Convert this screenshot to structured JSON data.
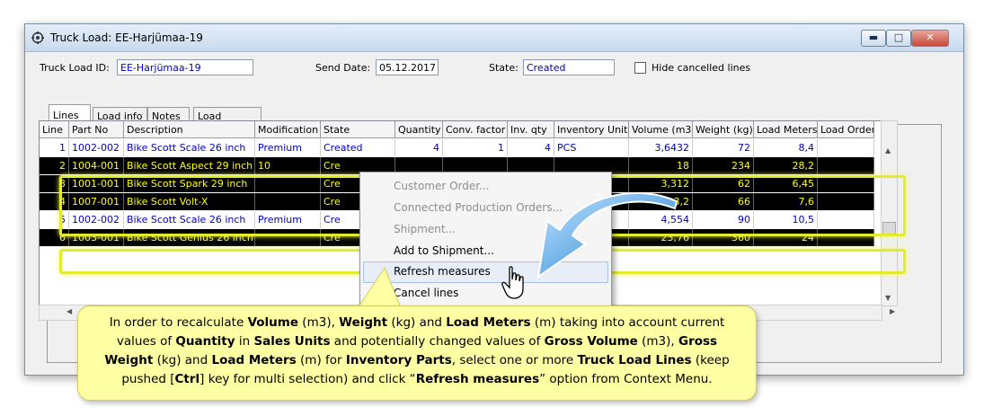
{
  "window": {
    "title": "Truck Load: EE-Harjümaa-19",
    "minimize_glyph": "▬",
    "maximize_glyph": "□",
    "close_glyph": "✕"
  },
  "header": {
    "truck_load_id_label": "Truck Load ID:",
    "truck_load_id_value": "EE-Harjümaa-19",
    "send_date_label": "Send Date:",
    "send_date_value": "05.12.2017",
    "state_label": "State:",
    "state_value": "Created",
    "hide_cancelled_label": "Hide cancelled lines",
    "hide_cancelled_checked": false
  },
  "tabs": [
    {
      "label": "Lines",
      "active": true
    },
    {
      "label": "Load info",
      "active": false
    },
    {
      "label": "Notes",
      "active": false
    },
    {
      "label": "Load history",
      "active": false
    }
  ],
  "grid": {
    "columns": [
      "Line",
      "Part No",
      "Description",
      "Modification",
      "State",
      "Quantity",
      "Conv. factor",
      "Inv. qty",
      "Inventory Unit",
      "Volume (m3)",
      "Weight (kg)",
      "Load Meters",
      "Load Order"
    ],
    "rows": [
      {
        "line": "1",
        "part_no": "1002-002",
        "description": "Bike Scott Scale 26 inch",
        "modification": "Premium",
        "state": "Created",
        "quantity": "4",
        "conv_factor": "1",
        "inv_qty": "4",
        "inv_unit": "PCS",
        "volume": "3,6432",
        "weight": "72",
        "load_meters": "8,4",
        "load_order": "",
        "selected": false
      },
      {
        "line": "2",
        "part_no": "1004-001",
        "description": "Bike Scott Aspect 29 inch",
        "modification": "10",
        "state": "Cre",
        "quantity": "",
        "conv_factor": "",
        "inv_qty": "",
        "inv_unit": "",
        "volume": "18",
        "weight": "234",
        "load_meters": "28,2",
        "load_order": "",
        "selected": true
      },
      {
        "line": "3",
        "part_no": "1001-001",
        "description": "Bike Scott Spark 29 inch",
        "modification": "",
        "state": "Cre",
        "quantity": "",
        "conv_factor": "",
        "inv_qty": "",
        "inv_unit": "",
        "volume": "3,312",
        "weight": "62",
        "load_meters": "6,45",
        "load_order": "",
        "selected": true
      },
      {
        "line": "4",
        "part_no": "1007-001",
        "description": "Bike Scott Volt-X",
        "modification": "",
        "state": "Cre",
        "quantity": "",
        "conv_factor": "",
        "inv_qty": "",
        "inv_unit": "",
        "volume": "3,2",
        "weight": "66",
        "load_meters": "7,6",
        "load_order": "",
        "selected": true
      },
      {
        "line": "5",
        "part_no": "1002-002",
        "description": "Bike Scott Scale 26 inch",
        "modification": "Premium",
        "state": "Cre",
        "quantity": "",
        "conv_factor": "",
        "inv_qty": "",
        "inv_unit": "",
        "volume": "4,554",
        "weight": "90",
        "load_meters": "10,5",
        "load_order": "",
        "selected": false
      },
      {
        "line": "6",
        "part_no": "1003-001",
        "description": "Bike Scott Genius 26 inch",
        "modification": "",
        "state": "Cre",
        "quantity": "",
        "conv_factor": "",
        "inv_qty": "",
        "inv_unit": "",
        "volume": "23,76",
        "weight": "360",
        "load_meters": "24",
        "load_order": "",
        "selected": true
      }
    ]
  },
  "context_menu": {
    "items": [
      {
        "label": "Customer Order...",
        "enabled": false
      },
      {
        "label": "Connected Production Orders...",
        "enabled": false
      },
      {
        "label": "Shipment...",
        "enabled": false
      },
      {
        "label": "Add to Shipment...",
        "enabled": true
      },
      {
        "label": "Refresh measures",
        "enabled": true,
        "hovered": true
      },
      {
        "label": "Cancel lines",
        "enabled": true
      }
    ]
  },
  "callout": {
    "t1": "In order to recalculate ",
    "b1": "Volume",
    "t2": " (m3), ",
    "b2": "Weight",
    "t3": " (kg) and ",
    "b3": "Load Meters",
    "t4": " (m) taking into account current values of ",
    "b4": "Quantity",
    "t5": " in ",
    "b5": "Sales Units",
    "t6": " and potentially changed values of ",
    "b6": "Gross Volume",
    "t7": " (m3), ",
    "b7": "Gross Weight",
    "t8": " (kg) and ",
    "b8": "Load Meters",
    "t9": " (m) for ",
    "b9": "Inventory Parts",
    "t10": ", select one or more ",
    "b10": "Truck Load Lines",
    "t11": " (keep pushed [",
    "b11": "Ctrl",
    "t12": "] key for multi selection) and click “",
    "b12": "Refresh measures",
    "t13": "” option from Context Menu."
  },
  "colors": {
    "selected_row_bg": "#000000",
    "selected_row_text": "#ffff00",
    "highlight_border": "#e2ec2c",
    "callout_bg": "#ffffa3",
    "arrow": "#2a8fd8"
  }
}
